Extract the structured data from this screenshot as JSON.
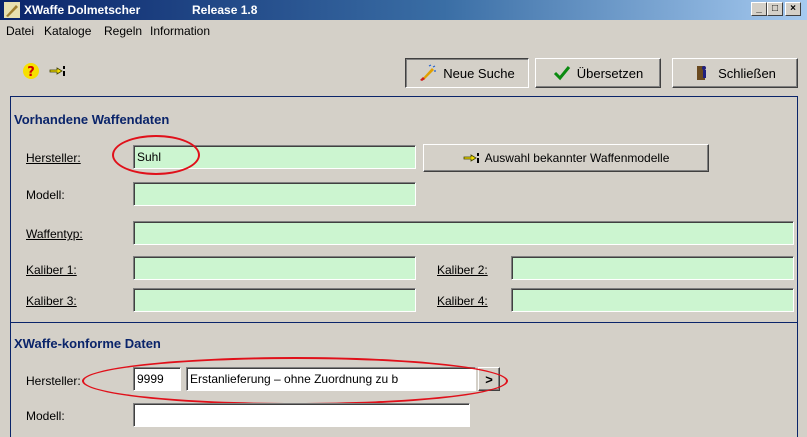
{
  "window": {
    "title": "XWaffe Dolmetscher",
    "release": "Release 1.8",
    "controls": {
      "minimize": "_",
      "maximize": "□",
      "close": "×"
    }
  },
  "menu": [
    "Datei",
    "Kataloge",
    "Regeln",
    "Information"
  ],
  "toolbar": {
    "icons": [
      "help-icon",
      "select-hand-icon"
    ],
    "new_search": "Neue Suche",
    "translate": "Übersetzen",
    "close": "Schließen"
  },
  "existing": {
    "title": "Vorhandene Waffendaten",
    "hersteller_label": "Hersteller:",
    "hersteller_value": "Suhl",
    "modell_label": "Modell:",
    "modell_value": "",
    "waffentyp_label": "Waffentyp:",
    "waffentyp_value": "",
    "kaliber1_label": "Kaliber 1:",
    "kaliber2_label": "Kaliber 2:",
    "kaliber3_label": "Kaliber 3:",
    "kaliber4_label": "Kaliber 4:",
    "select_models_button": "Auswahl bekannter Waffenmodelle"
  },
  "conform": {
    "title": "XWaffe-konforme Daten",
    "hersteller_label": "Hersteller:",
    "hersteller_code": "9999",
    "hersteller_text": "Erstanlieferung – ohne Zuordnung zu b",
    "arrow_button": ">",
    "modell_label": "Modell:",
    "modell_value": ""
  },
  "colors": {
    "field_bg": "#ccf5d0",
    "accent": "#0a246a",
    "highlight_oval": "#e0101a"
  }
}
